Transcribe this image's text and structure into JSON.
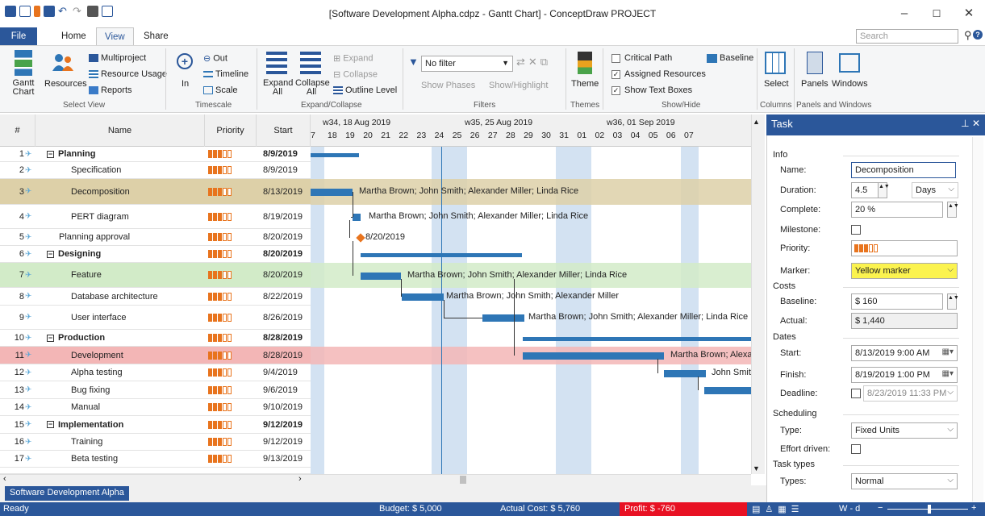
{
  "window": {
    "title": "[Software Development Alpha.cdpz - Gantt Chart] - ConceptDraw PROJECT",
    "min": "–",
    "max": "☐",
    "close": "✕"
  },
  "tabs": [
    "File",
    "Home",
    "View",
    "Share"
  ],
  "search": {
    "placeholder": "Search"
  },
  "ribbon": {
    "select_view": {
      "gantt": "Gantt Chart",
      "resources": "Resources",
      "multiproject": "Multiproject",
      "resource_usage": "Resource Usage",
      "reports": "Reports",
      "label": "Select View"
    },
    "timescale": {
      "in": "In",
      "out": "Out",
      "timeline": "Timeline",
      "scale": "Scale",
      "label": "Timescale"
    },
    "expand": {
      "expand_all": "Expand All",
      "collapse_all": "Collapse All",
      "expand": "Expand",
      "collapse": "Collapse",
      "outline": "Outline Level",
      "label": "Expand/Collapse"
    },
    "filters": {
      "filter": "No filter",
      "show_phases": "Show Phases",
      "show_highlight": "Show/Highlight",
      "label": "Filters"
    },
    "themes": {
      "theme": "Theme",
      "label": "Themes"
    },
    "showhide": {
      "critical": "Critical Path",
      "baseline": "Baseline",
      "assigned": "Assigned Resources",
      "textboxes": "Show Text Boxes",
      "label": "Show/Hide"
    },
    "columns": {
      "select": "Select",
      "label": "Columns"
    },
    "panels": {
      "panels": "Panels",
      "windows": "Windows",
      "label": "Panels and Windows"
    }
  },
  "grid": {
    "headers": {
      "num": "#",
      "name": "Name",
      "priority": "Priority",
      "start": "Start"
    },
    "rows": [
      {
        "n": "1",
        "name": "Planning",
        "start": "8/9/2019",
        "summary": true
      },
      {
        "n": "2",
        "name": "Specification",
        "start": "8/9/2019"
      },
      {
        "n": "3",
        "name": "Decomposition",
        "start": "8/13/2019"
      },
      {
        "n": "4",
        "name": "PERT diagram",
        "start": "8/19/2019"
      },
      {
        "n": "5",
        "name": "Planning approval",
        "start": "8/20/2019"
      },
      {
        "n": "6",
        "name": "Designing",
        "start": "8/20/2019",
        "summary": true
      },
      {
        "n": "7",
        "name": "Feature",
        "start": "8/20/2019"
      },
      {
        "n": "8",
        "name": "Database architecture",
        "start": "8/22/2019"
      },
      {
        "n": "9",
        "name": "User interface",
        "start": "8/26/2019"
      },
      {
        "n": "10",
        "name": "Production",
        "start": "8/28/2019",
        "summary": true
      },
      {
        "n": "11",
        "name": "Development",
        "start": "8/28/2019"
      },
      {
        "n": "12",
        "name": "Alpha testing",
        "start": "9/4/2019"
      },
      {
        "n": "13",
        "name": "Bug fixing",
        "start": "9/6/2019"
      },
      {
        "n": "14",
        "name": "Manual",
        "start": "9/10/2019"
      },
      {
        "n": "15",
        "name": "Implementation",
        "start": "9/12/2019",
        "summary": true
      },
      {
        "n": "16",
        "name": "Training",
        "start": "9/12/2019"
      },
      {
        "n": "17",
        "name": "Beta testing",
        "start": "9/13/2019"
      }
    ]
  },
  "gantt": {
    "weeks": [
      "w34, 18 Aug 2019",
      "w35, 25 Aug 2019",
      "w36, 01 Sep 2019"
    ],
    "days": [
      "7",
      "18",
      "19",
      "20",
      "21",
      "22",
      "23",
      "24",
      "25",
      "26",
      "27",
      "28",
      "29",
      "30",
      "31",
      "01",
      "02",
      "03",
      "04",
      "05",
      "06",
      "07"
    ],
    "labels": {
      "decomp": "Martha Brown; John Smith; Alexander Miller; Linda Rice",
      "pert": "Martha Brown; John Smith; Alexander Miller; Linda Rice",
      "milestone": "8/20/2019",
      "feature": "Martha Brown; John Smith; Alexander Miller; Linda Rice",
      "db": "Martha Brown; John Smith; Alexander Miller",
      "ui": "Martha Brown; John Smith; Alexander Miller; Linda Rice",
      "dev": "Martha Brown; Alexa",
      "alpha": "John Smit"
    }
  },
  "task": {
    "title": "Task",
    "info": "Info",
    "name_l": "Name:",
    "name": "Decomposition",
    "duration_l": "Duration:",
    "duration": "4.5",
    "duration_unit": "Days",
    "complete_l": "Complete:",
    "complete": "20 %",
    "milestone_l": "Milestone:",
    "priority_l": "Priority:",
    "marker_l": "Marker:",
    "marker": "Yellow marker",
    "costs": "Costs",
    "baseline_l": "Baseline:",
    "baseline": "$ 160",
    "actual_l": "Actual:",
    "actual": "$ 1,440",
    "dates": "Dates",
    "start_l": "Start:",
    "start": "8/13/2019  9:00 AM",
    "finish_l": "Finish:",
    "finish": "8/19/2019  1:00 PM",
    "deadline_l": "Deadline:",
    "deadline": "8/23/2019 11:33 PM",
    "scheduling": "Scheduling",
    "type_l": "Type:",
    "type": "Fixed Units",
    "effort_l": "Effort driven:",
    "tasktypes": "Task types",
    "types_l": "Types:",
    "types": "Normal"
  },
  "sheet": "Software Development Alpha",
  "status": {
    "ready": "Ready",
    "budget": "Budget: $ 5,000",
    "actual": "Actual Cost: $ 5,760",
    "profit": "Profit: $ -760",
    "scale": "W - d"
  },
  "colors": {
    "accent": "#2b579a",
    "bar": "#2e76b6",
    "priority": "#e8741e",
    "profit_bg": "#e81123"
  }
}
